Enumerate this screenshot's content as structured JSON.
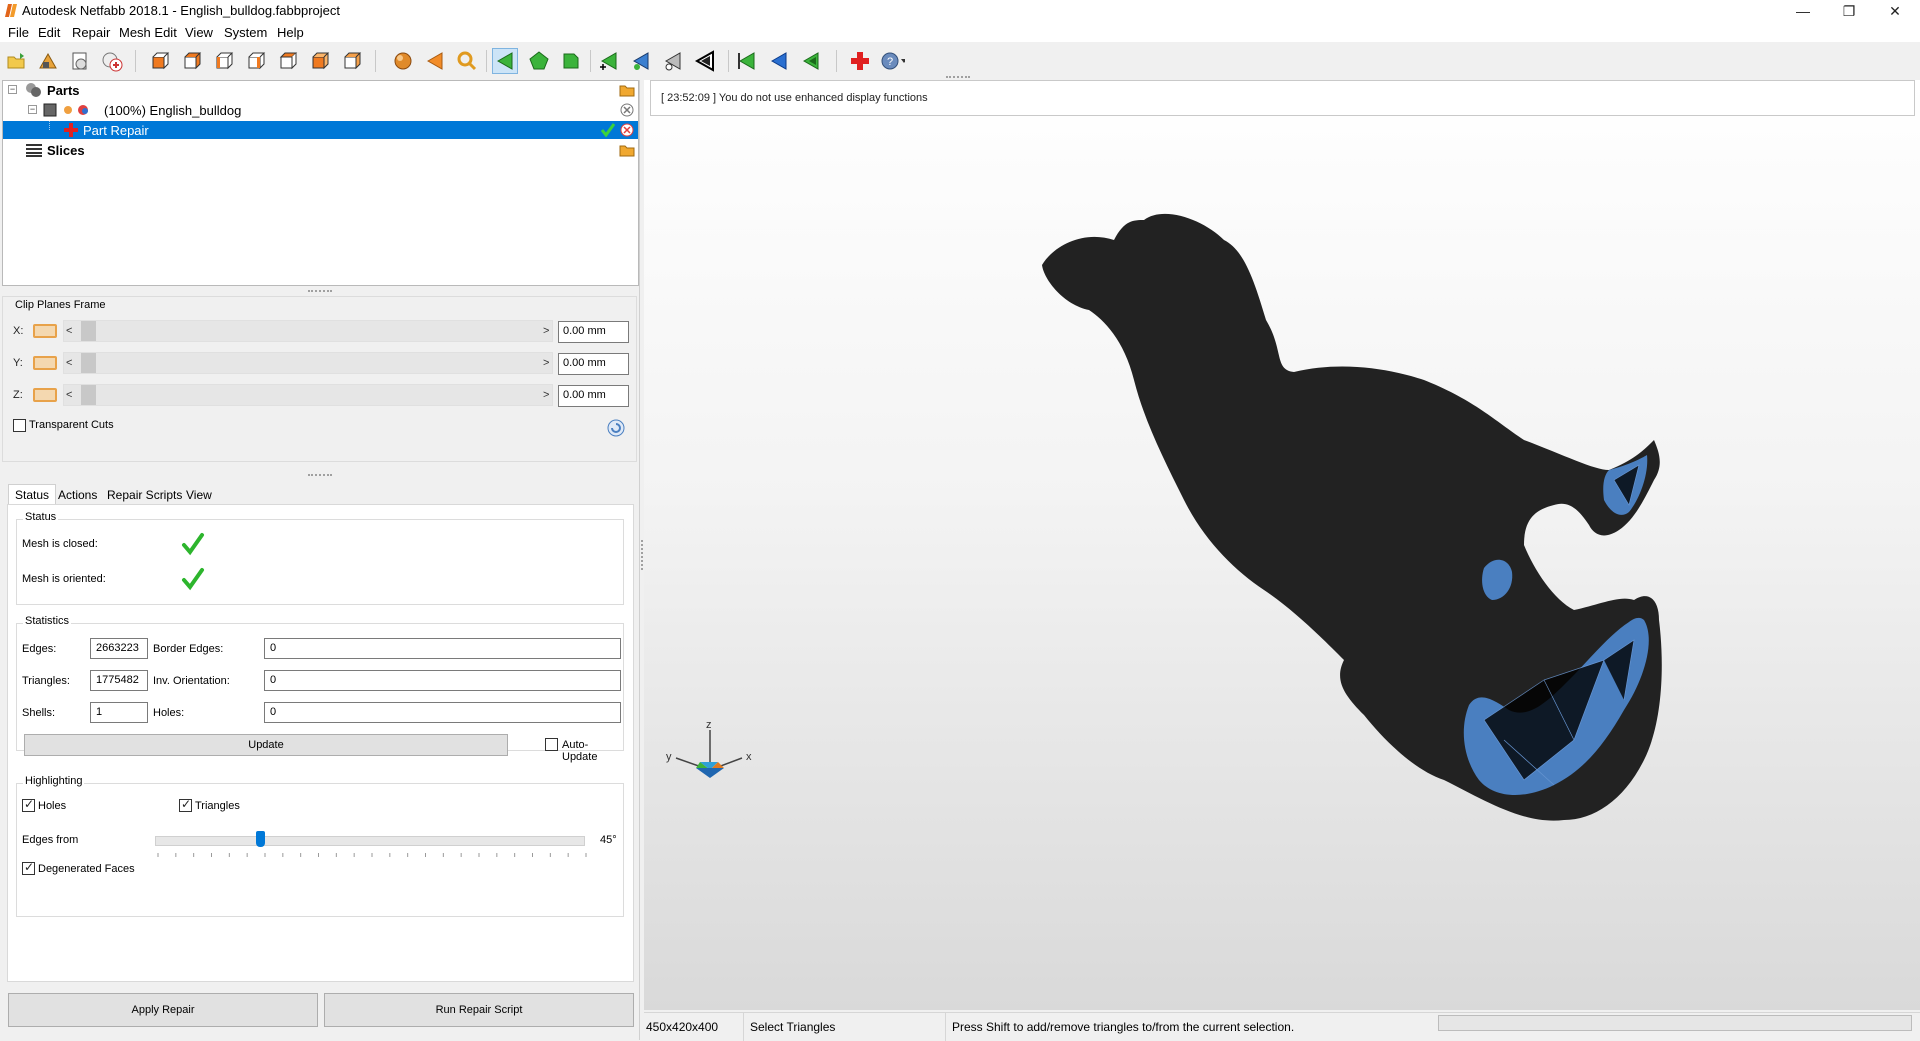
{
  "window": {
    "title": "Autodesk Netfabb 2018.1 - English_bulldog.fabbproject",
    "minimize_glyph": "—",
    "maximize_glyph": "❐",
    "close_glyph": "✕"
  },
  "menu": [
    "File",
    "Edit",
    "Repair",
    "Mesh Edit",
    "View",
    "System",
    "Help"
  ],
  "tree": {
    "parts_label": "Parts",
    "part_label": "(100%) English_bulldog",
    "repair_label": "Part Repair",
    "slices_label": "Slices"
  },
  "clip": {
    "title": "Clip Planes Frame",
    "x_label": "X:",
    "y_label": "Y:",
    "z_label": "Z:",
    "x_value": "0.00 mm",
    "y_value": "0.00 mm",
    "z_value": "0.00 mm",
    "left_arrow": "<",
    "right_arrow": ">",
    "transparent_cuts": "Transparent Cuts"
  },
  "tabs": [
    "Status",
    "Actions",
    "Repair Scripts",
    "View"
  ],
  "status": {
    "group_title": "Status",
    "mesh_closed": "Mesh is closed:",
    "mesh_oriented": "Mesh is oriented:"
  },
  "statistics": {
    "group_title": "Statistics",
    "edges_label": "Edges:",
    "edges_value": "2663223",
    "border_edges_label": "Border Edges:",
    "border_edges_value": "0",
    "triangles_label": "Triangles:",
    "triangles_value": "1775482",
    "inv_orientation_label": "Inv. Orientation:",
    "inv_orientation_value": "0",
    "shells_label": "Shells:",
    "shells_value": "1",
    "holes_label": "Holes:",
    "holes_value": "0",
    "update_button": "Update",
    "auto_update": "Auto-Update"
  },
  "highlighting": {
    "group_title": "Highlighting",
    "holes": "Holes",
    "triangles": "Triangles",
    "edges_from": "Edges from",
    "angle_value": "45°",
    "degenerated_faces": "Degenerated Faces",
    "angle_fraction": 0.25
  },
  "buttons": {
    "apply_repair": "Apply Repair",
    "run_repair_script": "Run Repair Script"
  },
  "log_message": "[ 23:52:09 ] You do not use enhanced display functions",
  "axes": {
    "z": "z",
    "y": "y",
    "x": "x"
  },
  "statusbar": {
    "dimensions": "450x420x400",
    "mode": "Select Triangles",
    "hint": "Press Shift to add/remove triangles to/from the current selection."
  },
  "colors": {
    "selection": "#0078d7",
    "mesh": "#222222",
    "highlight": "#4a7fc0",
    "check": "#2db52d"
  }
}
